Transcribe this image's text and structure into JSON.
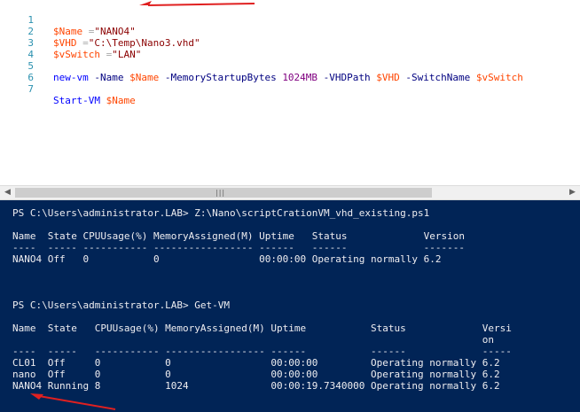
{
  "editor": {
    "lines": [
      {
        "num": "1",
        "parts": [
          {
            "t": "$Name",
            "c": "var"
          },
          {
            "t": " =",
            "c": "op"
          },
          {
            "t": "\"NANO4\"",
            "c": "str"
          }
        ]
      },
      {
        "num": "2",
        "parts": [
          {
            "t": "$VHD",
            "c": "var"
          },
          {
            "t": " =",
            "c": "op"
          },
          {
            "t": "\"C:\\Temp\\Nano3.vhd\"",
            "c": "str"
          }
        ]
      },
      {
        "num": "3",
        "parts": [
          {
            "t": "$vSwitch",
            "c": "var"
          },
          {
            "t": " =",
            "c": "op"
          },
          {
            "t": "\"LAN\"",
            "c": "str"
          }
        ]
      },
      {
        "num": "4",
        "parts": []
      },
      {
        "num": "5",
        "parts": [
          {
            "t": "new-vm",
            "c": "cmd"
          },
          {
            "t": " -Name ",
            "c": "param"
          },
          {
            "t": "$Name",
            "c": "var"
          },
          {
            "t": " -MemoryStartupBytes ",
            "c": "param"
          },
          {
            "t": "1024MB",
            "c": "num"
          },
          {
            "t": " -VHDPath ",
            "c": "param"
          },
          {
            "t": "$VHD",
            "c": "var"
          },
          {
            "t": " -SwitchName ",
            "c": "param"
          },
          {
            "t": "$vSwitch",
            "c": "var"
          }
        ]
      },
      {
        "num": "6",
        "parts": []
      },
      {
        "num": "7",
        "parts": [
          {
            "t": "Start-VM",
            "c": "cmd"
          },
          {
            "t": " ",
            "c": "plain"
          },
          {
            "t": "$Name",
            "c": "var"
          }
        ]
      }
    ]
  },
  "scrollbar": {
    "left_glyph": "◀",
    "right_glyph": "▶",
    "grip": "|||"
  },
  "console": {
    "lines": [
      "PS C:\\Users\\administrator.LAB> Z:\\Nano\\scriptCrationVM_vhd_existing.ps1",
      "",
      "Name  State CPUUsage(%) MemoryAssigned(M) Uptime   Status             Version",
      "----  ----- ----------- ----------------- ------   ------             -------",
      "NANO4 Off   0           0                 00:00:00 Operating normally 6.2",
      "",
      "",
      "",
      "PS C:\\Users\\administrator.LAB> Get-VM",
      "",
      "Name  State   CPUUsage(%) MemoryAssigned(M) Uptime           Status             Versi",
      "                                                                                on",
      "----  -----   ----------- ----------------- ------           ------             -----",
      "CL01  Off     0           0                 00:00:00         Operating normally 6.2",
      "nano  Off     0           0                 00:00:00         Operating normally 6.2",
      "NANO4 Running 8           1024              00:00:19.7340000 Operating normally 6.2"
    ]
  },
  "colors": {
    "console_bg": "#012456",
    "console_fg": "#eeedf0",
    "arrow": "#e02020",
    "line_number": "#2b91af"
  }
}
